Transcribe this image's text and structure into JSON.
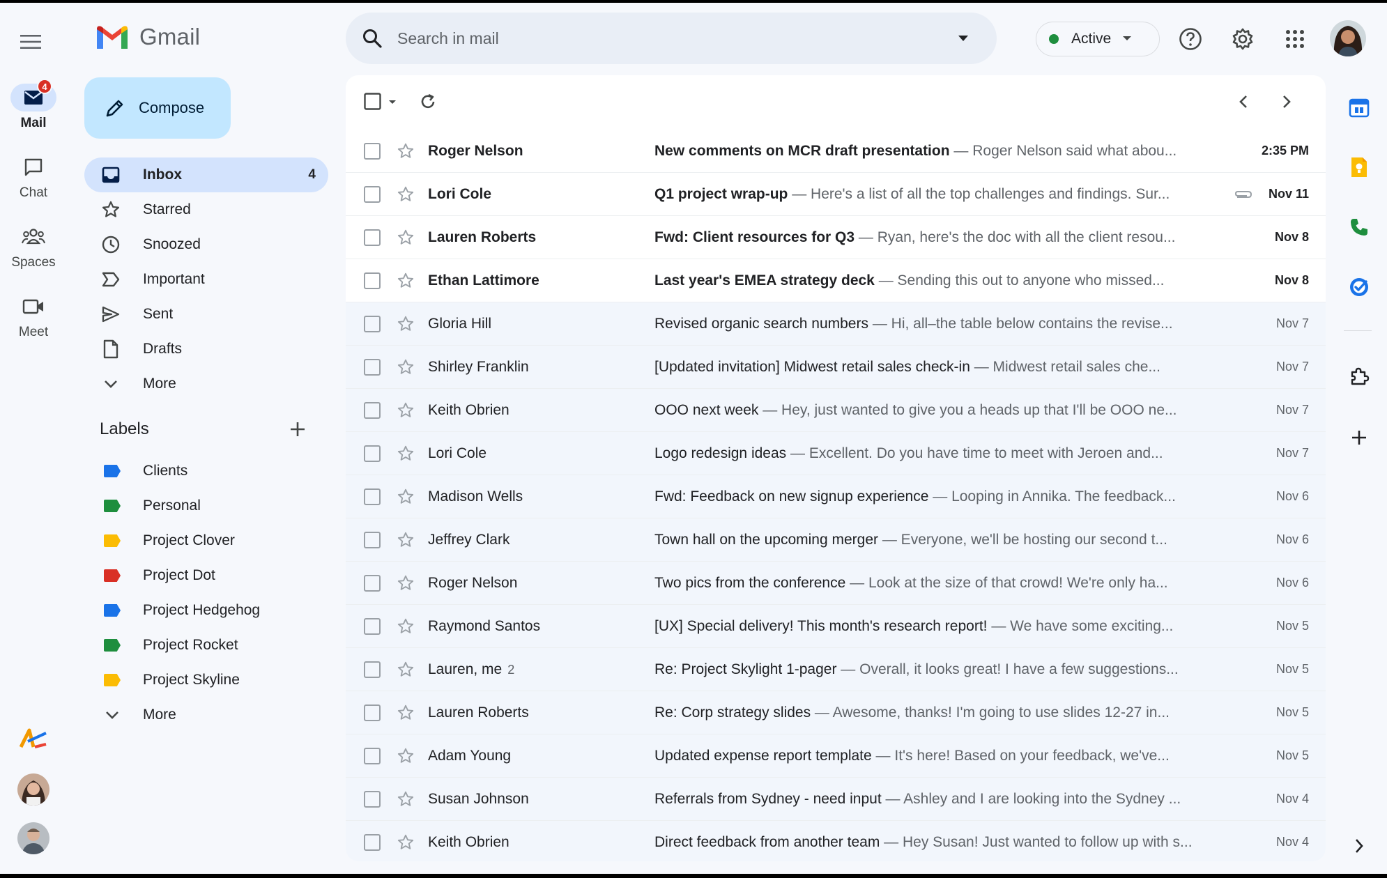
{
  "app": {
    "name": "Gmail"
  },
  "rail": {
    "items": [
      {
        "label": "Mail",
        "badge": "4"
      },
      {
        "label": "Chat"
      },
      {
        "label": "Spaces"
      },
      {
        "label": "Meet"
      }
    ]
  },
  "compose": {
    "label": "Compose"
  },
  "nav": {
    "items": [
      {
        "label": "Inbox",
        "count": "4"
      },
      {
        "label": "Starred"
      },
      {
        "label": "Snoozed"
      },
      {
        "label": "Important"
      },
      {
        "label": "Sent"
      },
      {
        "label": "Drafts"
      },
      {
        "label": "More"
      }
    ]
  },
  "labels": {
    "title": "Labels",
    "items": [
      {
        "label": "Clients",
        "color": "#1a73e8"
      },
      {
        "label": "Personal",
        "color": "#1e8e3e"
      },
      {
        "label": "Project Clover",
        "color": "#fbbc04"
      },
      {
        "label": "Project Dot",
        "color": "#d93025"
      },
      {
        "label": "Project Hedgehog",
        "color": "#1a73e8"
      },
      {
        "label": "Project Rocket",
        "color": "#1e8e3e"
      },
      {
        "label": "Project Skyline",
        "color": "#fbbc04"
      }
    ],
    "more": "More"
  },
  "search": {
    "placeholder": "Search in mail"
  },
  "status": {
    "label": "Active",
    "color": "#1e8e3e"
  },
  "emails": [
    {
      "sender": "Roger Nelson",
      "subject": "New comments on MCR draft presentation",
      "snippet": " — Roger Nelson said what abou...",
      "date": "2:35 PM",
      "unread": true
    },
    {
      "sender": "Lori Cole",
      "subject": "Q1 project wrap-up",
      "snippet": " — Here's a list of all the top challenges and findings. Sur...",
      "date": "Nov 11",
      "unread": true,
      "attachment": true
    },
    {
      "sender": "Lauren Roberts",
      "subject": "Fwd: Client resources for Q3",
      "snippet": " — Ryan, here's the doc with all the client resou...",
      "date": "Nov 8",
      "unread": true
    },
    {
      "sender": "Ethan Lattimore",
      "subject": "Last year's EMEA strategy deck",
      "snippet": " — Sending this out to anyone who missed...",
      "date": "Nov 8",
      "unread": true
    },
    {
      "sender": "Gloria Hill",
      "subject": "Revised organic search numbers",
      "snippet": " — Hi, all–the table below contains the revise...",
      "date": "Nov 7",
      "unread": false
    },
    {
      "sender": "Shirley Franklin",
      "subject": "[Updated invitation] Midwest retail sales check-in",
      "snippet": " — Midwest retail sales che...",
      "date": "Nov 7",
      "unread": false
    },
    {
      "sender": "Keith Obrien",
      "subject": "OOO next week",
      "snippet": " — Hey, just wanted to give you a heads up that I'll be OOO ne...",
      "date": "Nov 7",
      "unread": false
    },
    {
      "sender": "Lori Cole",
      "subject": "Logo redesign ideas",
      "snippet": " — Excellent. Do you have time to meet with Jeroen and...",
      "date": "Nov 7",
      "unread": false
    },
    {
      "sender": "Madison Wells",
      "subject": "Fwd: Feedback on new signup experience",
      "snippet": " — Looping in Annika. The feedback...",
      "date": "Nov 6",
      "unread": false
    },
    {
      "sender": "Jeffrey Clark",
      "subject": "Town hall on the upcoming merger",
      "snippet": " — Everyone, we'll be hosting our second t...",
      "date": "Nov 6",
      "unread": false
    },
    {
      "sender": "Roger Nelson",
      "subject": "Two pics from the conference",
      "snippet": " — Look at the size of that crowd! We're only ha...",
      "date": "Nov 6",
      "unread": false
    },
    {
      "sender": "Raymond Santos",
      "subject": "[UX] Special delivery! This month's research report!",
      "snippet": " — We have some exciting...",
      "date": "Nov 5",
      "unread": false
    },
    {
      "sender": "Lauren, me",
      "thread_count": "2",
      "subject": "Re: Project Skylight 1-pager",
      "snippet": " — Overall, it looks great! I have a few suggestions...",
      "date": "Nov 5",
      "unread": false
    },
    {
      "sender": "Lauren Roberts",
      "subject": "Re: Corp strategy slides",
      "snippet": " — Awesome, thanks! I'm going to use slides 12-27 in...",
      "date": "Nov 5",
      "unread": false
    },
    {
      "sender": "Adam Young",
      "subject": "Updated expense report template",
      "snippet": " — It's here! Based on your feedback, we've...",
      "date": "Nov 5",
      "unread": false
    },
    {
      "sender": "Susan Johnson",
      "subject": "Referrals from Sydney - need input",
      "snippet": " — Ashley and I are looking into the Sydney ...",
      "date": "Nov 4",
      "unread": false
    },
    {
      "sender": "Keith Obrien",
      "subject": "Direct feedback from another team",
      "snippet": " — Hey Susan! Just wanted to follow up with s...",
      "date": "Nov 4",
      "unread": false
    }
  ]
}
